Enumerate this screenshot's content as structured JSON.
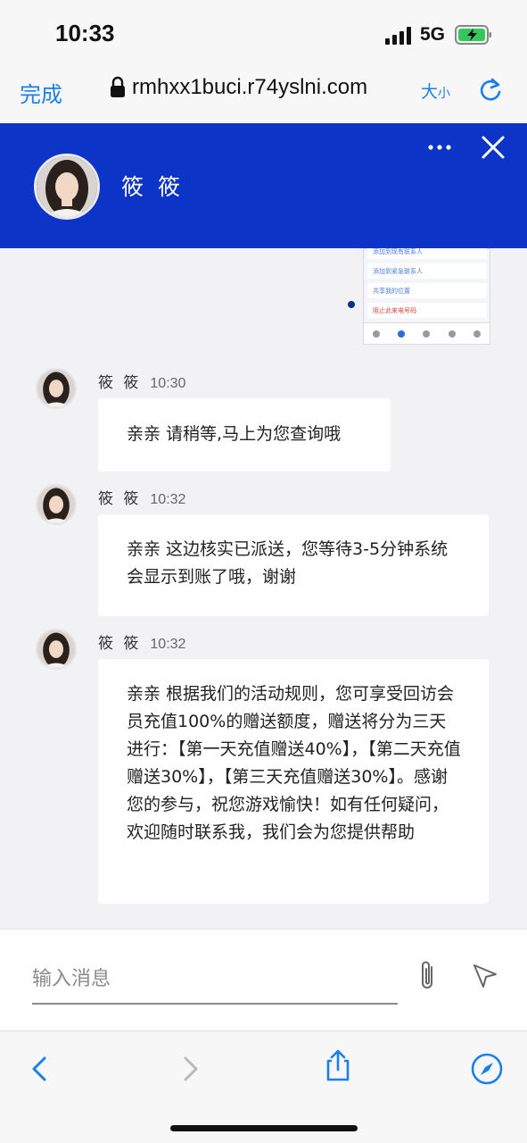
{
  "status_bar": {
    "time": "10:33",
    "network": "5G"
  },
  "browser": {
    "done_label": "完成",
    "url": "rmhxx1buci.r74yslni.com",
    "text_size_label_big": "大",
    "text_size_label_small": "小"
  },
  "chat": {
    "agent_name": "筱 筱",
    "thumbnail_rows": [
      "添加到现有联系人",
      "添加到紧急联系人",
      "共享我的位置",
      "阻止此来电号码"
    ],
    "messages": [
      {
        "sender": "筱 筱",
        "time": "10:30",
        "text": "亲亲 请稍等,马上为您查询哦"
      },
      {
        "sender": "筱 筱",
        "time": "10:32",
        "text": "亲亲 这边核实已派送，您等待3-5分钟系统会显示到账了哦，谢谢"
      },
      {
        "sender": "筱 筱",
        "time": "10:32",
        "text": "亲亲 根据我们的活动规则，您可享受回访会员充值100%的赠送额度，赠送将分为三天进行：【第一天充值赠送40%】，【第二天充值赠送30%】，【第三天充值赠送30%】。感谢您的参与，祝您游戏愉快！如有任何疑问，欢迎随时联系我，我们会为您提供帮助"
      }
    ]
  },
  "composer": {
    "placeholder": "输入消息"
  },
  "colors": {
    "header_bg": "#0c35c8",
    "ios_blue": "#1a7ff0"
  }
}
